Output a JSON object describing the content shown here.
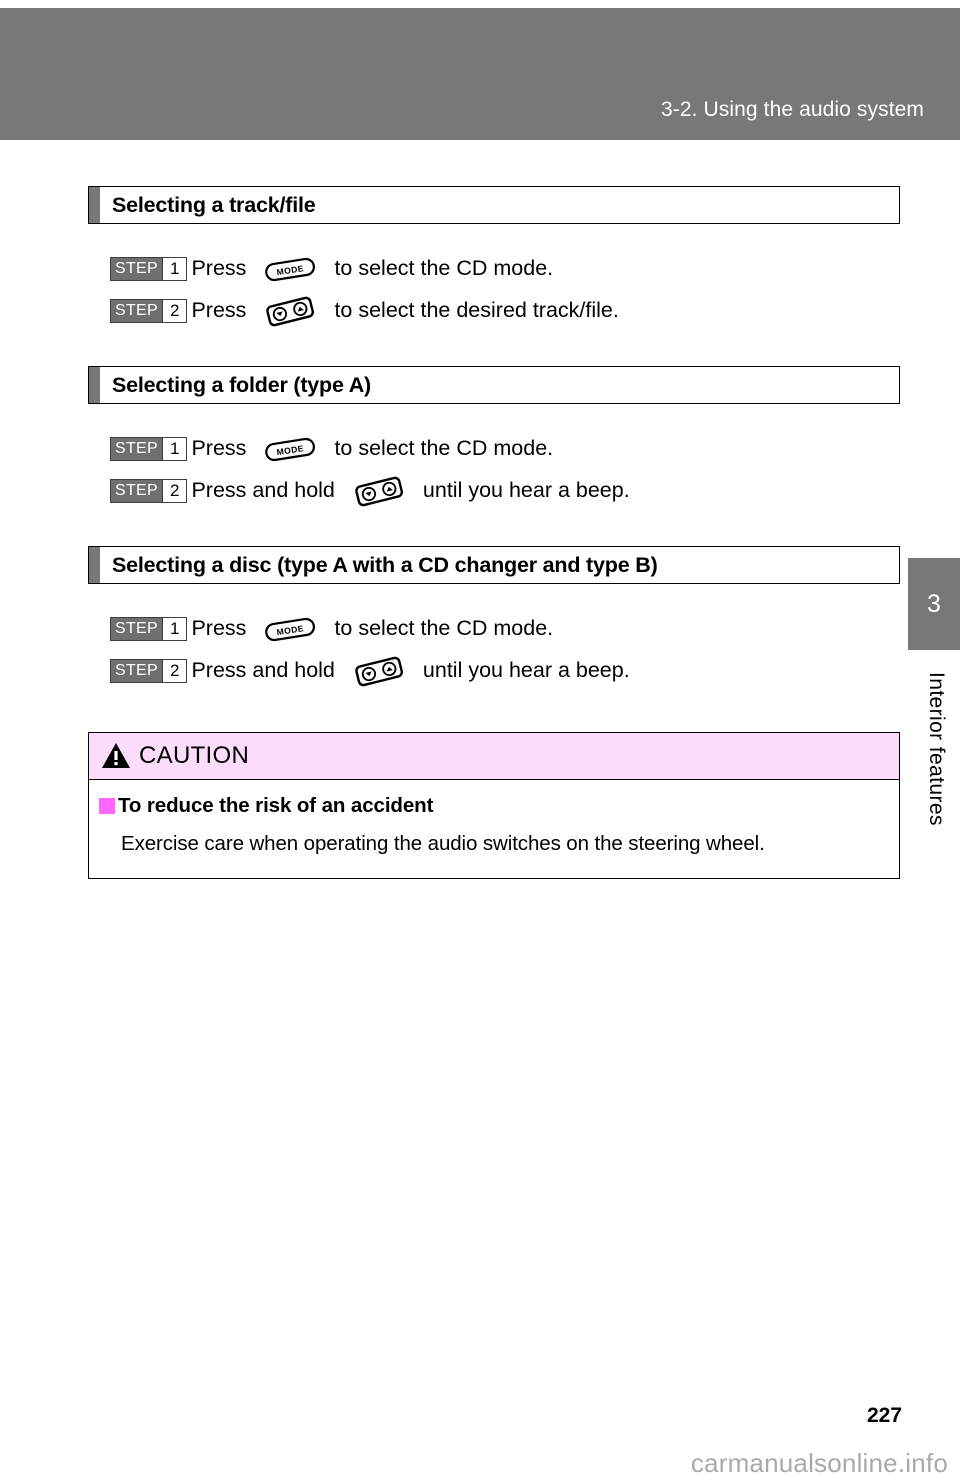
{
  "header": {
    "chapter_title": "3-2. Using the audio system"
  },
  "side_tab": {
    "chapter_number": "3",
    "chapter_label": "Interior features"
  },
  "sections": [
    {
      "title": "Selecting a track/file",
      "steps": [
        {
          "badge_word": "STEP",
          "badge_num": "1",
          "text_before": "Press",
          "icon": "mode-button-icon",
          "text_after": "to select the CD mode."
        },
        {
          "badge_word": "STEP",
          "badge_num": "2",
          "text_before": "Press",
          "icon": "seek-updown-button-icon",
          "text_after": "to select the desired track/file."
        }
      ]
    },
    {
      "title": "Selecting a folder (type A)",
      "steps": [
        {
          "badge_word": "STEP",
          "badge_num": "1",
          "text_before": "Press",
          "icon": "mode-button-icon",
          "text_after": "to select the CD mode."
        },
        {
          "badge_word": "STEP",
          "badge_num": "2",
          "text_before": "Press and hold",
          "icon": "seek-updown-button-icon",
          "text_after": "until you hear a beep."
        }
      ]
    },
    {
      "title": "Selecting a disc (type A with a CD changer and type B)",
      "steps": [
        {
          "badge_word": "STEP",
          "badge_num": "1",
          "text_before": "Press",
          "icon": "mode-button-icon",
          "text_after": "to select the CD mode."
        },
        {
          "badge_word": "STEP",
          "badge_num": "2",
          "text_before": "Press and hold",
          "icon": "seek-updown-button-icon",
          "text_after": "until you hear a beep."
        }
      ]
    }
  ],
  "caution": {
    "label": "CAUTION",
    "subheading": "To reduce the risk of an accident",
    "body": "Exercise care when operating the audio switches on the steering wheel."
  },
  "icon_labels": {
    "mode": "MODE"
  },
  "footer": {
    "page_number": "227",
    "watermark": "carmanualsonline.info"
  },
  "colors": {
    "band_gray": "#787878",
    "caution_pink": "#fbddfb",
    "bullet_magenta": "#ff66ff",
    "watermark_gray": "#a9a9a9"
  }
}
